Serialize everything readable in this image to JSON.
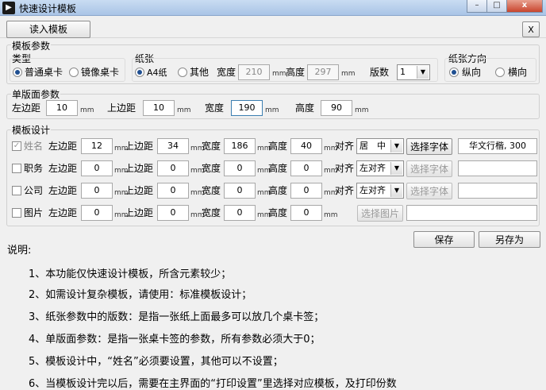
{
  "window": {
    "title": "快速设计模板",
    "min_glyph": "–",
    "max_glyph": "□",
    "close_glyph": "x"
  },
  "toolbar": {
    "load_template_label": "读入模板",
    "close_label": "X"
  },
  "template_params": {
    "legend": "模板参数",
    "type": {
      "label": "类型",
      "options": [
        {
          "label": "普通桌卡",
          "selected": true
        },
        {
          "label": "镜像桌卡",
          "selected": false
        }
      ]
    },
    "paper": {
      "label": "纸张",
      "options": [
        {
          "label": "A4纸",
          "selected": true
        },
        {
          "label": "其他",
          "selected": false
        }
      ],
      "width_label": "宽度",
      "width_value": "210",
      "height_label": "高度",
      "height_value": "297",
      "unit": "mm",
      "copies_label": "版数",
      "copies_value": "1"
    },
    "orientation": {
      "label": "纸张方向",
      "options": [
        {
          "label": "纵向",
          "selected": true
        },
        {
          "label": "横向",
          "selected": false
        }
      ]
    }
  },
  "single_params": {
    "legend": "单版面参数",
    "left_label": "左边距",
    "left_value": "10",
    "top_label": "上边距",
    "top_value": "10",
    "width_label": "宽度",
    "width_value": "190",
    "height_label": "高度",
    "height_value": "90",
    "unit": "mm"
  },
  "design": {
    "legend": "模板设计",
    "left_label": "左边距",
    "top_label": "上边距",
    "width_label": "宽度",
    "height_label": "高度",
    "align_label": "对齐",
    "unit": "mm",
    "rows": [
      {
        "name": "姓名",
        "checked": true,
        "left": "12",
        "top": "34",
        "width": "186",
        "height": "40",
        "align": "居　中",
        "button": "选择字体",
        "font": "华文行楷, 300"
      },
      {
        "name": "职务",
        "checked": false,
        "left": "0",
        "top": "0",
        "width": "0",
        "height": "0",
        "align": "左对齐",
        "button": "选择字体",
        "font": ""
      },
      {
        "name": "公司",
        "checked": false,
        "left": "0",
        "top": "0",
        "width": "0",
        "height": "0",
        "align": "左对齐",
        "button": "选择字体",
        "font": ""
      },
      {
        "name": "图片",
        "checked": false,
        "left": "0",
        "top": "0",
        "width": "0",
        "height": "0",
        "align": "",
        "button": "选择图片",
        "font": ""
      }
    ]
  },
  "actions": {
    "save_label": "保存",
    "save_as_label": "另存为"
  },
  "notes": {
    "heading": "说明:",
    "lines": [
      "1、本功能仅快速设计模板，所含元素较少；",
      "2、如需设计复杂模板，请使用：标准模板设计；",
      "3、纸张参数中的版数：是指一张纸上面最多可以放几个桌卡签；",
      "4、单版面参数：是指一张桌卡签的参数，所有参数必须大于0；",
      "5、模板设计中，“姓名”必须要设置，其他可以不设置；",
      "6、当模板设计完以后，需要在主界面的“打印设置”里选择对应模板，及打印份数"
    ]
  }
}
